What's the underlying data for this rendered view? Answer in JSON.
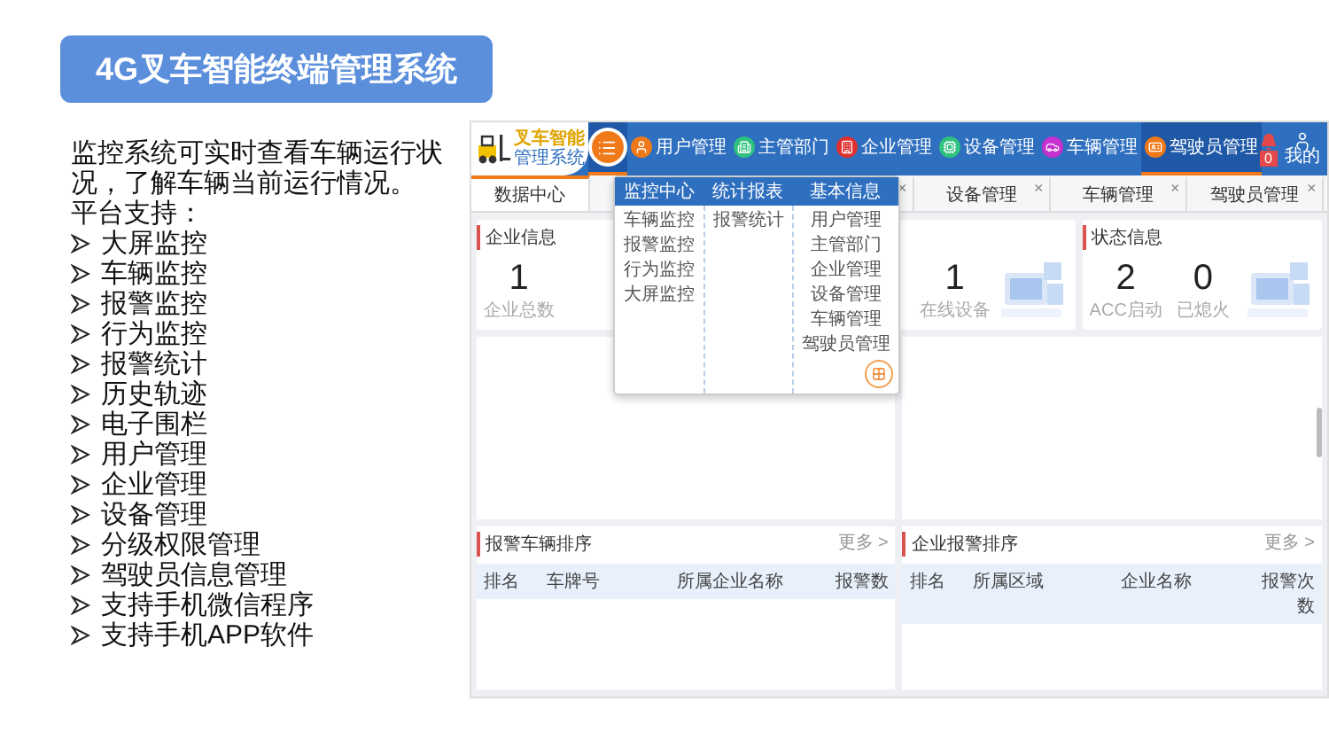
{
  "slide": {
    "title": "4G叉车智能终端管理系统",
    "intro": "监控系统可实时查看车辆运行状况，了解车辆当前运行情况。",
    "support_label": "平台支持：",
    "features": [
      "大屏监控",
      "车辆监控",
      "报警监控",
      "行为监控",
      "报警统计",
      "历史轨迹",
      "电子围栏",
      "用户管理",
      "企业管理",
      "设备管理",
      "分级权限管理",
      "驾驶员信息管理",
      "支持手机微信程序",
      "支持手机APP软件"
    ]
  },
  "app": {
    "logo": {
      "title": "叉车智能",
      "subtitle": "管理系统"
    },
    "nav": [
      {
        "kind": "menu",
        "color": "#f07a1a",
        "selected": true
      },
      {
        "kind": "user",
        "label": "用户管理",
        "color": "#f07a1a",
        "selected": false
      },
      {
        "kind": "dept",
        "label": "主管部门",
        "color": "#2ec27e",
        "selected": false
      },
      {
        "kind": "company",
        "label": "企业管理",
        "color": "#e0312f",
        "selected": false
      },
      {
        "kind": "device",
        "label": "设备管理",
        "color": "#2ec27e",
        "selected": false
      },
      {
        "kind": "car",
        "label": "车辆管理",
        "color": "#c62fd0",
        "selected": false
      },
      {
        "kind": "driver",
        "label": "驾驶员管理",
        "color": "#f07a1a",
        "selected": true
      }
    ],
    "alarm_count": "0",
    "user_label": "我的",
    "tabs": [
      {
        "label": "数据中心",
        "selected": true
      },
      {
        "close": "×",
        "selected": false
      },
      {
        "label": "设备管理",
        "close": "×",
        "selected": false
      },
      {
        "label": "车辆管理",
        "close": "×",
        "selected": false
      },
      {
        "label": "驾驶员管理",
        "close": "×",
        "selected": false
      }
    ],
    "menu": {
      "columns": [
        {
          "title": "监控中心",
          "items": [
            "车辆监控",
            "报警监控",
            "行为监控",
            "大屏监控"
          ]
        },
        {
          "title": "统计报表",
          "items": [
            "报警统计"
          ]
        },
        {
          "title": "基本信息",
          "items": [
            "用户管理",
            "主管部门",
            "企业管理",
            "设备管理",
            "车辆管理",
            "驾驶员管理"
          ]
        }
      ]
    },
    "cards": [
      {
        "title": "企业信息",
        "stats": [
          {
            "value": "1",
            "label": "企业总数"
          },
          {
            "value": "1",
            "label": "在线设备"
          }
        ]
      },
      {
        "title": "状态信息",
        "stats": [
          {
            "value": "2",
            "label": "ACC启动"
          },
          {
            "value": "0",
            "label": "已熄火"
          }
        ]
      }
    ],
    "tables": [
      {
        "title": "报警车辆排序",
        "more": "更多 >",
        "columns": [
          "排名",
          "车牌号",
          "所属企业名称",
          "报警数"
        ]
      },
      {
        "title": "企业报警排序",
        "more": "更多 >",
        "columns": [
          "排名",
          "所属区域",
          "企业名称",
          "报警次数"
        ]
      }
    ]
  }
}
